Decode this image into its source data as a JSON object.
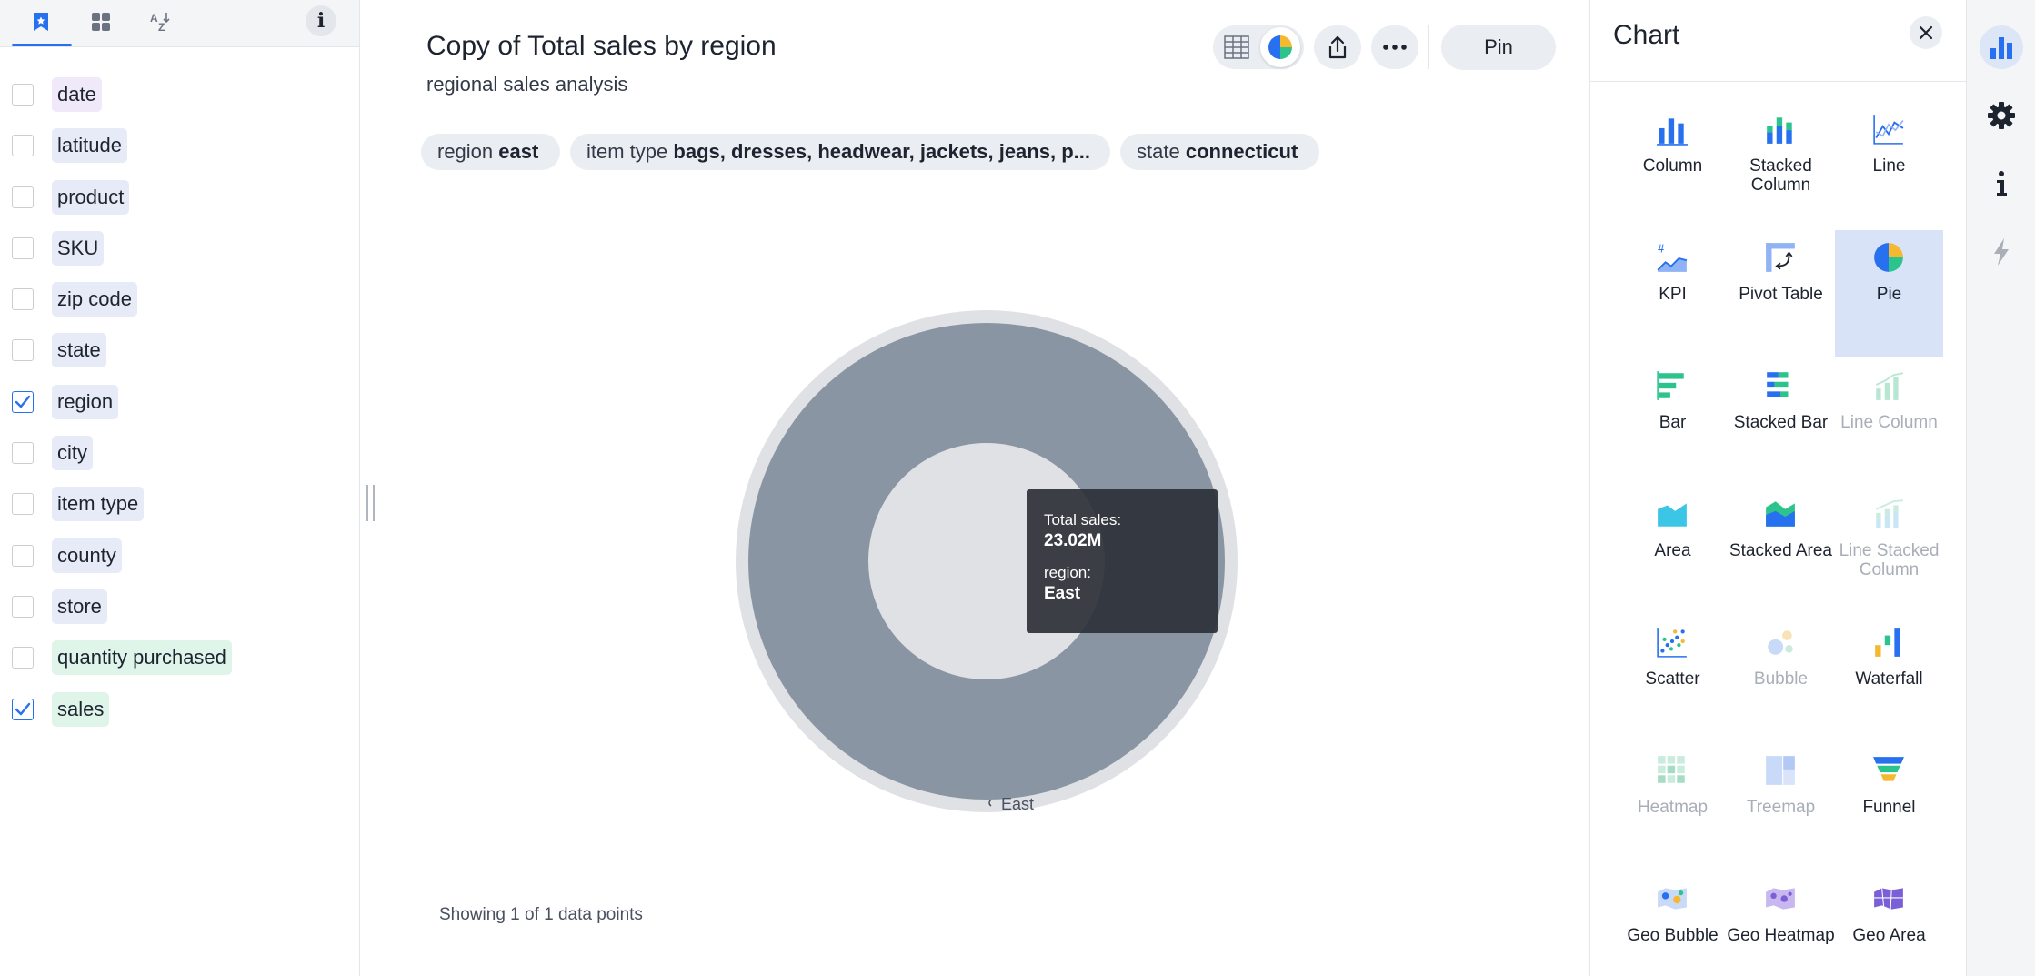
{
  "colors": {
    "accent": "#2770ef",
    "pie_slice": "#8a95a3",
    "pie_ring": "#dfe1e5",
    "tooltip_bg": "#2d3037"
  },
  "left_panel": {
    "tabs": [
      {
        "icon": "bookmark-icon",
        "active": true
      },
      {
        "icon": "grid-icon",
        "active": false
      },
      {
        "icon": "sort-az-icon",
        "active": false
      }
    ],
    "info_label": "i",
    "fields": [
      {
        "label": "date",
        "type": "date",
        "checked": false
      },
      {
        "label": "latitude",
        "type": "attribute",
        "checked": false
      },
      {
        "label": "product",
        "type": "attribute",
        "checked": false
      },
      {
        "label": "SKU",
        "type": "attribute",
        "checked": false
      },
      {
        "label": "zip code",
        "type": "attribute",
        "checked": false
      },
      {
        "label": "state",
        "type": "attribute",
        "checked": false
      },
      {
        "label": "region",
        "type": "attribute",
        "checked": true
      },
      {
        "label": "city",
        "type": "attribute",
        "checked": false
      },
      {
        "label": "item type",
        "type": "attribute",
        "checked": false
      },
      {
        "label": "county",
        "type": "attribute",
        "checked": false
      },
      {
        "label": "store",
        "type": "attribute",
        "checked": false
      },
      {
        "label": "quantity purchased",
        "type": "measure",
        "checked": false
      },
      {
        "label": "sales",
        "type": "measure",
        "checked": true
      }
    ]
  },
  "main": {
    "title": "Copy of Total sales by region",
    "subtitle": "regional sales analysis",
    "toolbar": {
      "pin_label": "Pin",
      "icons": [
        "table-view-icon",
        "pie-chart-view-icon",
        "share-icon",
        "more-icon"
      ]
    },
    "filters": [
      {
        "name": "region",
        "value": "east"
      },
      {
        "name": "item type",
        "value": "bags, dresses, headwear, jackets, jeans, p..."
      },
      {
        "name": "state",
        "value": "connecticut"
      }
    ],
    "tooltip": {
      "key1": "Total sales:",
      "value1": "23.02M",
      "key2": "region:",
      "value2": "East"
    },
    "data_points_note": "Showing 1 of 1 data points"
  },
  "chart_data": {
    "type": "pie",
    "categories": [
      "East"
    ],
    "values": [
      23.02
    ],
    "series": [
      {
        "name": "Total sales",
        "values": [
          23.02
        ]
      }
    ],
    "value_unit": "M",
    "legend": "none"
  },
  "chart_panel": {
    "title": "Chart",
    "types": [
      {
        "label": "Column",
        "icon": "column-chart-icon",
        "selected": false,
        "disabled": false
      },
      {
        "label": "Stacked Column",
        "icon": "stacked-column-chart-icon",
        "selected": false,
        "disabled": false
      },
      {
        "label": "Line",
        "icon": "line-chart-icon",
        "selected": false,
        "disabled": false
      },
      {
        "label": "KPI",
        "icon": "kpi-chart-icon",
        "selected": false,
        "disabled": false
      },
      {
        "label": "Pivot Table",
        "icon": "pivot-table-icon",
        "selected": false,
        "disabled": false
      },
      {
        "label": "Pie",
        "icon": "pie-chart-icon",
        "selected": true,
        "disabled": false
      },
      {
        "label": "Bar",
        "icon": "bar-chart-icon",
        "selected": false,
        "disabled": false
      },
      {
        "label": "Stacked Bar",
        "icon": "stacked-bar-chart-icon",
        "selected": false,
        "disabled": false
      },
      {
        "label": "Line Column",
        "icon": "line-column-chart-icon",
        "selected": false,
        "disabled": true
      },
      {
        "label": "Area",
        "icon": "area-chart-icon",
        "selected": false,
        "disabled": false
      },
      {
        "label": "Stacked Area",
        "icon": "stacked-area-chart-icon",
        "selected": false,
        "disabled": false
      },
      {
        "label": "Line Stacked Column",
        "icon": "line-stacked-column-chart-icon",
        "selected": false,
        "disabled": true
      },
      {
        "label": "Scatter",
        "icon": "scatter-chart-icon",
        "selected": false,
        "disabled": false
      },
      {
        "label": "Bubble",
        "icon": "bubble-chart-icon",
        "selected": false,
        "disabled": true
      },
      {
        "label": "Waterfall",
        "icon": "waterfall-chart-icon",
        "selected": false,
        "disabled": false
      },
      {
        "label": "Heatmap",
        "icon": "heatmap-chart-icon",
        "selected": false,
        "disabled": true
      },
      {
        "label": "Treemap",
        "icon": "treemap-chart-icon",
        "selected": false,
        "disabled": true
      },
      {
        "label": "Funnel",
        "icon": "funnel-chart-icon",
        "selected": false,
        "disabled": false
      },
      {
        "label": "Geo Bubble",
        "icon": "geo-bubble-chart-icon",
        "selected": false,
        "disabled": false
      },
      {
        "label": "Geo Heatmap",
        "icon": "geo-heatmap-chart-icon",
        "selected": false,
        "disabled": false
      },
      {
        "label": "Geo Area",
        "icon": "geo-area-chart-icon",
        "selected": false,
        "disabled": false
      }
    ]
  },
  "icon_rail": [
    {
      "icon": "chart-settings-icon",
      "active": true
    },
    {
      "icon": "gear-icon",
      "active": false
    },
    {
      "icon": "info-icon",
      "active": false
    },
    {
      "icon": "lightning-icon",
      "active": false
    }
  ]
}
